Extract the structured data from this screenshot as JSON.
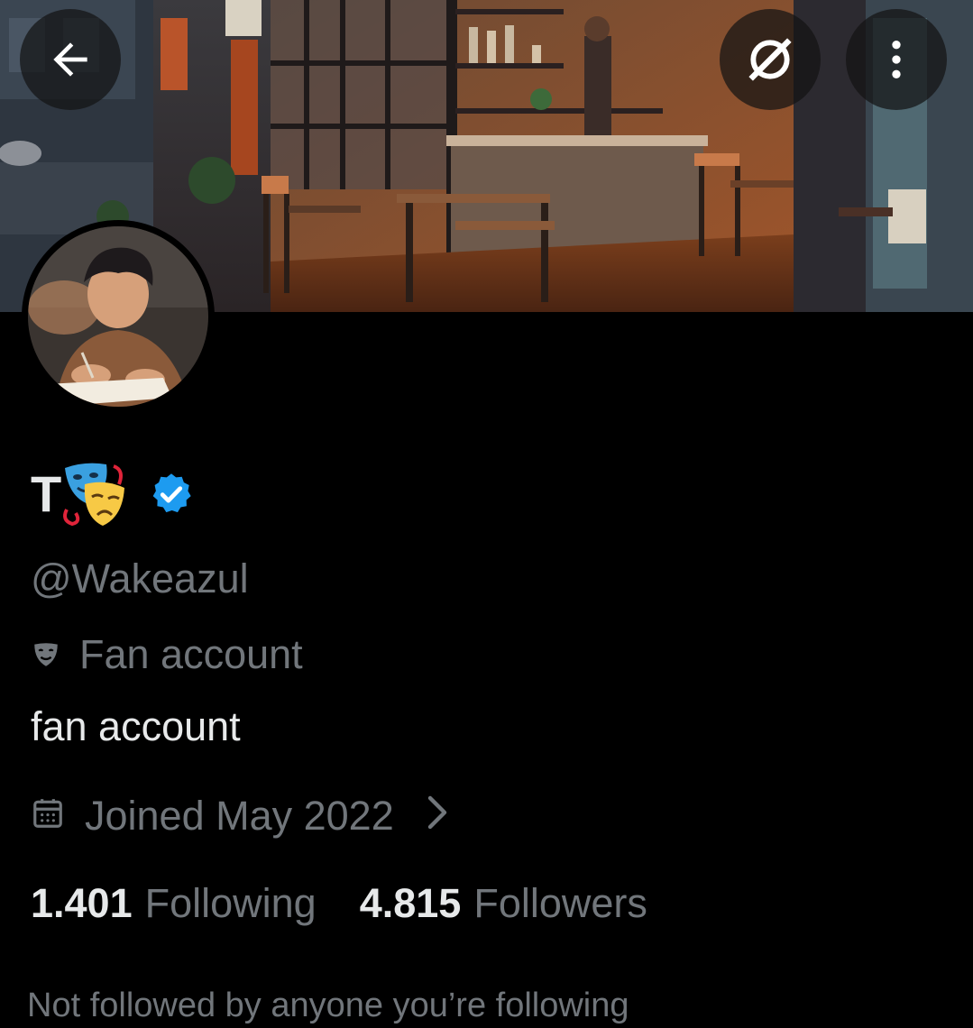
{
  "banner": {
    "description_icon": "cafe-night-illustration"
  },
  "top_bar": {
    "back_icon": "arrow-left-icon",
    "grok_icon": "grok-icon",
    "more_icon": "more-vertical-icon"
  },
  "profile": {
    "display_name": "T",
    "name_emoji": "performing-arts-emoji",
    "verified": true,
    "verified_color": "#1d9bf0",
    "handle": "@Wakeazul",
    "category_icon": "theater-mask-icon",
    "category": "Fan account",
    "bio": "fan account",
    "joined_icon": "calendar-icon",
    "joined": "Joined May 2022",
    "following_count": "1.401",
    "following_label": "Following",
    "followers_count": "4.815",
    "followers_label": "Followers",
    "mutuals_note": "Not followed by anyone you’re following"
  },
  "colors": {
    "background": "#000000",
    "primary_text": "#e7e9ea",
    "secondary_text": "#71767b",
    "accent": "#1d9bf0"
  }
}
